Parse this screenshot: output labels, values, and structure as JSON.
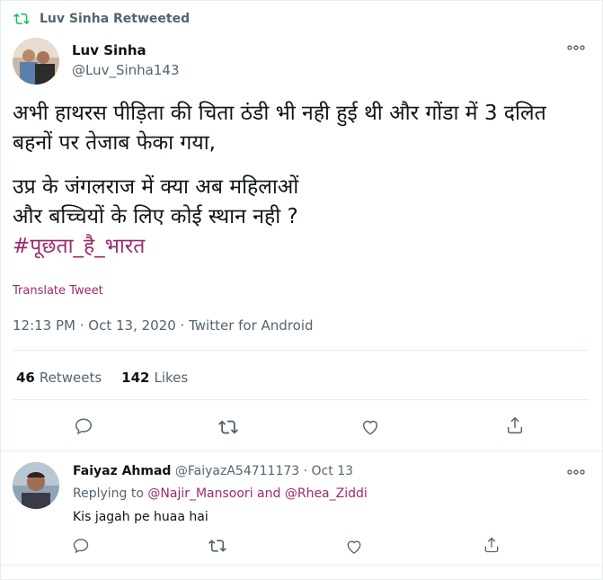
{
  "retweet_header": {
    "label": "Luv Sinha Retweeted",
    "icon": "retweet-icon"
  },
  "tweet": {
    "author_name": "Luv Sinha",
    "author_handle": "@Luv_Sinha143",
    "text_line1": "अभी हाथरस पीड़िता की चिता ठंडी भी नही हुई थी और गोंडा में 3 दलित बहनों पर तेजाब फेका गया,",
    "text_line2": "उप्र के जंगलराज में क्या अब महिलाओं",
    "text_line3": "और बच्चियों के लिए कोई स्थान नही ?",
    "hashtag": "#पूछता_है_भारत",
    "translate_label": "Translate Tweet",
    "meta": "12:13 PM · Oct 13, 2020 · Twitter for Android",
    "retweets_count": "46",
    "retweets_label": "Retweets",
    "likes_count": "142",
    "likes_label": "Likes"
  },
  "reply": {
    "author_name": "Faiyaz Ahmad",
    "author_meta": "@FaiyazA54711173 · Oct 13",
    "replying_prefix": "Replying to",
    "mention1": "@Najir_Mansoori",
    "and_word": "and",
    "mention2": "@Rhea_Ziddi",
    "text": "Kis jagah pe huaa hai"
  },
  "colors": {
    "accent": "#9c2a6b",
    "muted": "#536471",
    "retweet_green": "#17bf63"
  }
}
